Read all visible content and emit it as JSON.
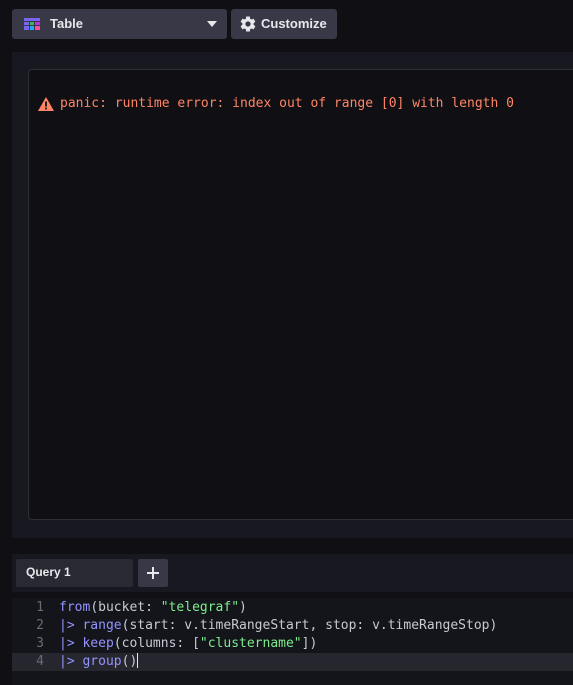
{
  "toolbar": {
    "viz_type_label": "Table",
    "customize_label": "Customize",
    "viz_icon": "table-grid-icon",
    "customize_icon": "gear-icon"
  },
  "visualization": {
    "error_icon": "warning-icon",
    "error_message": "panic: runtime error: index out of range [0] with length 0"
  },
  "query_tabs": {
    "tabs": [
      {
        "label": "Query 1"
      }
    ],
    "add_icon": "plus-icon"
  },
  "editor": {
    "lines": [
      {
        "number": "1",
        "tokens": [
          {
            "t": "from",
            "k": "fn"
          },
          {
            "t": "(bucket: ",
            "k": "plain"
          },
          {
            "t": "\"telegraf\"",
            "k": "str"
          },
          {
            "t": ")",
            "k": "plain"
          }
        ]
      },
      {
        "number": "2",
        "tokens": [
          {
            "t": "|> ",
            "k": "pipe"
          },
          {
            "t": "range",
            "k": "fn"
          },
          {
            "t": "(start: v.timeRangeStart, stop: v.timeRangeStop)",
            "k": "plain"
          }
        ]
      },
      {
        "number": "3",
        "tokens": [
          {
            "t": "|> ",
            "k": "pipe"
          },
          {
            "t": "keep",
            "k": "fn"
          },
          {
            "t": "(columns: [",
            "k": "plain"
          },
          {
            "t": "\"clustername\"",
            "k": "str"
          },
          {
            "t": "])",
            "k": "plain"
          }
        ]
      },
      {
        "number": "4",
        "tokens": [
          {
            "t": "|> ",
            "k": "pipe"
          },
          {
            "t": "group",
            "k": "fn"
          },
          {
            "t": "()",
            "k": "plain"
          }
        ]
      }
    ]
  },
  "colors": {
    "error": "#ff8564",
    "keyword": "#9394ff",
    "string": "#7eed8e",
    "background": "#0f0f14"
  }
}
